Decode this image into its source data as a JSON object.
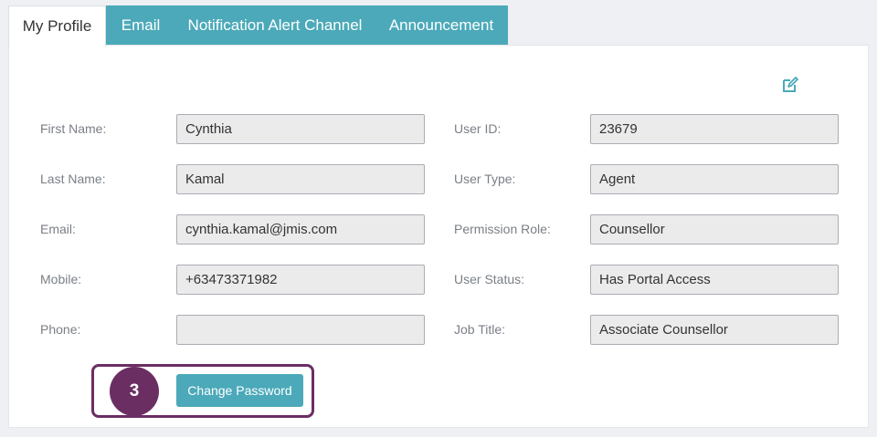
{
  "tabs": [
    {
      "label": "My Profile",
      "active": true
    },
    {
      "label": "Email",
      "active": false
    },
    {
      "label": "Notification Alert Channel",
      "active": false
    },
    {
      "label": "Announcement",
      "active": false
    }
  ],
  "colors": {
    "accent": "#4ba9b9",
    "highlight": "#6b2e63"
  },
  "icons": {
    "edit": "edit-square-icon"
  },
  "form": {
    "first_name": {
      "label": "First Name:",
      "value": "Cynthia"
    },
    "last_name": {
      "label": "Last Name:",
      "value": "Kamal"
    },
    "email": {
      "label": "Email:",
      "value": "cynthia.kamal@jmis.com"
    },
    "mobile": {
      "label": "Mobile:",
      "value": "+63473371982"
    },
    "phone": {
      "label": "Phone:",
      "value": ""
    },
    "user_id": {
      "label": "User ID:",
      "value": "23679"
    },
    "user_type": {
      "label": "User Type:",
      "value": "Agent"
    },
    "permission_role": {
      "label": "Permission Role:",
      "value": "Counsellor"
    },
    "user_status": {
      "label": "User Status:",
      "value": "Has Portal Access"
    },
    "job_title": {
      "label": "Job Title:",
      "value": "Associate Counsellor"
    }
  },
  "step_number": "3",
  "change_password_label": "Change Password"
}
